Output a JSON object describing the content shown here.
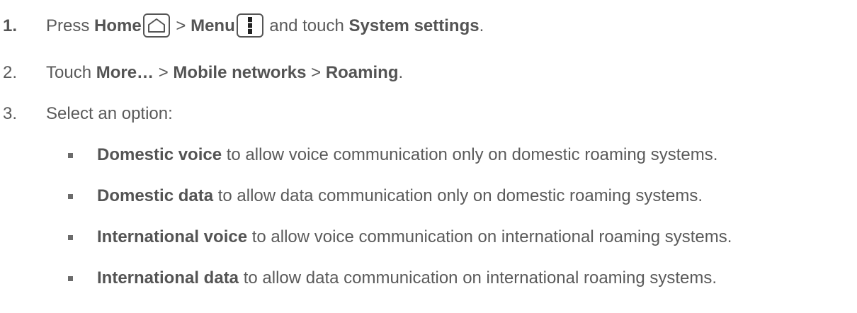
{
  "steps": [
    {
      "number": "1.",
      "parts": {
        "press": "Press",
        "home": "Home",
        "sep1": ">",
        "menu": "Menu",
        "and_touch": "and touch",
        "system_settings": "System settings",
        "end": "."
      }
    },
    {
      "number": "2.",
      "parts": {
        "touch": "Touch",
        "more": "More…",
        "sep1": ">",
        "mobile_networks": "Mobile networks",
        "sep2": ">",
        "roaming": "Roaming",
        "end": "."
      }
    },
    {
      "number": "3.",
      "parts": {
        "text": "Select an option:"
      }
    }
  ],
  "options": [
    {
      "term": "Domestic voice",
      "desc": "to allow voice communication only on domestic roaming systems."
    },
    {
      "term": "Domestic data",
      "desc": "to allow data communication only on domestic roaming systems."
    },
    {
      "term": "International voice",
      "desc": "to allow voice communication on international roaming systems."
    },
    {
      "term": "International data",
      "desc": "to allow data communication on international roaming systems."
    }
  ],
  "icons": {
    "home": "home-key-icon",
    "menu": "menu-key-icon"
  }
}
